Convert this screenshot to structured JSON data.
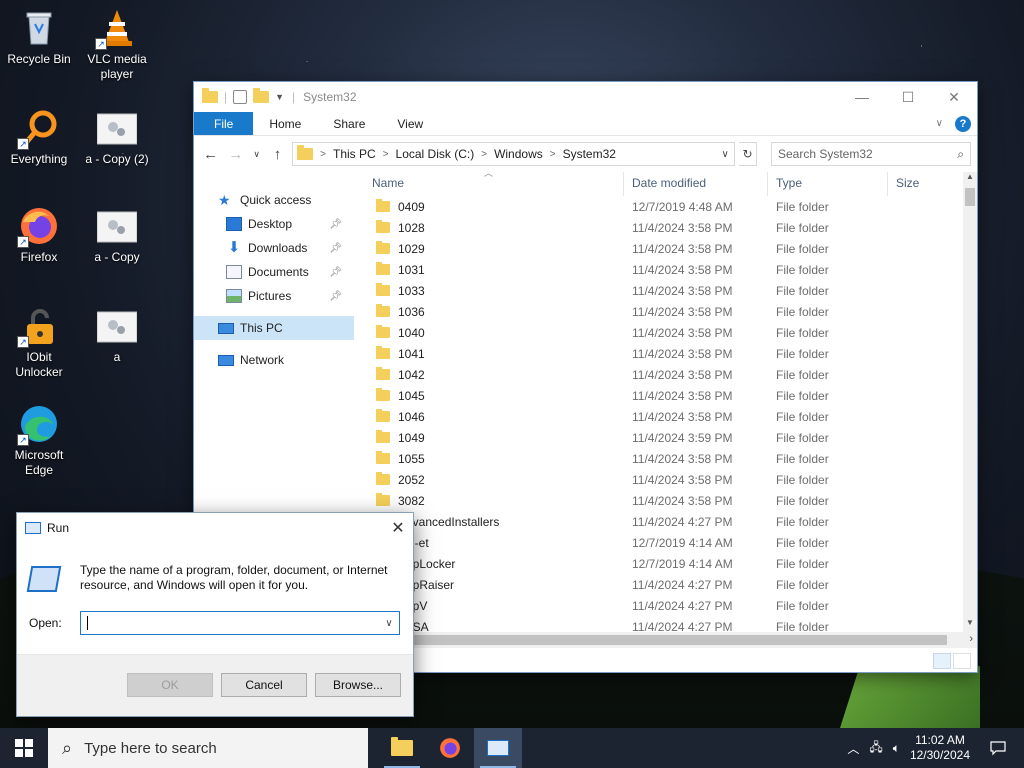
{
  "desktop": {
    "icons": [
      {
        "label": "Recycle Bin"
      },
      {
        "label": "VLC media player"
      },
      {
        "label": "Everything"
      },
      {
        "label": "a - Copy (2)"
      },
      {
        "label": "Firefox"
      },
      {
        "label": "a - Copy"
      },
      {
        "label": "IObit Unlocker"
      },
      {
        "label": "a"
      },
      {
        "label": "Microsoft Edge"
      }
    ]
  },
  "explorer": {
    "title": "System32",
    "ribbon_tabs": [
      "File",
      "Home",
      "Share",
      "View"
    ],
    "address": [
      "This PC",
      "Local Disk (C:)",
      "Windows",
      "System32"
    ],
    "search_placeholder": "Search System32",
    "nav": {
      "quick_access": "Quick access",
      "desktop": "Desktop",
      "downloads": "Downloads",
      "documents": "Documents",
      "pictures": "Pictures",
      "this_pc": "This PC",
      "network": "Network"
    },
    "columns": {
      "name": "Name",
      "date": "Date modified",
      "type": "Type",
      "size": "Size"
    },
    "rows": [
      {
        "name": "0409",
        "date": "12/7/2019 4:48 AM",
        "type": "File folder"
      },
      {
        "name": "1028",
        "date": "11/4/2024 3:58 PM",
        "type": "File folder"
      },
      {
        "name": "1029",
        "date": "11/4/2024 3:58 PM",
        "type": "File folder"
      },
      {
        "name": "1031",
        "date": "11/4/2024 3:58 PM",
        "type": "File folder"
      },
      {
        "name": "1033",
        "date": "11/4/2024 3:58 PM",
        "type": "File folder"
      },
      {
        "name": "1036",
        "date": "11/4/2024 3:58 PM",
        "type": "File folder"
      },
      {
        "name": "1040",
        "date": "11/4/2024 3:58 PM",
        "type": "File folder"
      },
      {
        "name": "1041",
        "date": "11/4/2024 3:58 PM",
        "type": "File folder"
      },
      {
        "name": "1042",
        "date": "11/4/2024 3:58 PM",
        "type": "File folder"
      },
      {
        "name": "1045",
        "date": "11/4/2024 3:58 PM",
        "type": "File folder"
      },
      {
        "name": "1046",
        "date": "11/4/2024 3:58 PM",
        "type": "File folder"
      },
      {
        "name": "1049",
        "date": "11/4/2024 3:59 PM",
        "type": "File folder"
      },
      {
        "name": "1055",
        "date": "11/4/2024 3:58 PM",
        "type": "File folder"
      },
      {
        "name": "2052",
        "date": "11/4/2024 3:58 PM",
        "type": "File folder"
      },
      {
        "name": "3082",
        "date": "11/4/2024 3:58 PM",
        "type": "File folder"
      },
      {
        "name": "AdvancedInstallers",
        "date": "11/4/2024 4:27 PM",
        "type": "File folder"
      },
      {
        "name": "am-et",
        "date": "12/7/2019 4:14 AM",
        "type": "File folder"
      },
      {
        "name": "AppLocker",
        "date": "12/7/2019 4:14 AM",
        "type": "File folder"
      },
      {
        "name": "AppRaiser",
        "date": "11/4/2024 4:27 PM",
        "type": "File folder"
      },
      {
        "name": "AppV",
        "date": "11/4/2024 4:27 PM",
        "type": "File folder"
      },
      {
        "name": "ar-SA",
        "date": "11/4/2024 4:27 PM",
        "type": "File folder"
      }
    ]
  },
  "run": {
    "title": "Run",
    "description": "Type the name of a program, folder, document, or Internet resource, and Windows will open it for you.",
    "open_label": "Open:",
    "open_value": "",
    "ok": "OK",
    "cancel": "Cancel",
    "browse": "Browse..."
  },
  "taskbar": {
    "search_placeholder": "Type here to search",
    "time": "11:02 AM",
    "date": "12/30/2024"
  }
}
